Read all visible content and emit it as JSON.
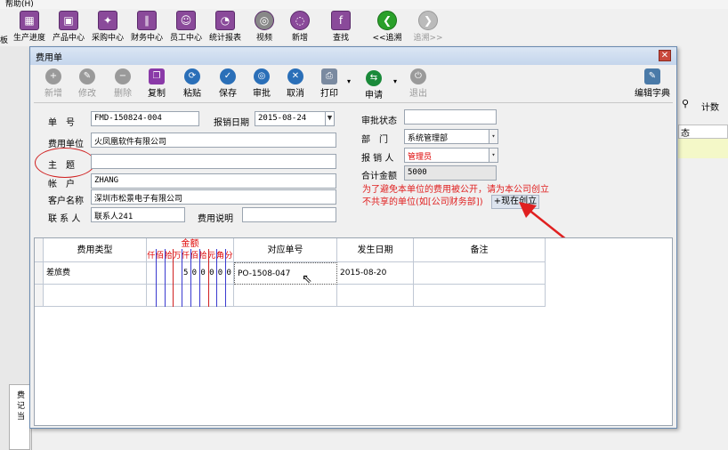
{
  "app": {
    "menu": "帮助(H)"
  },
  "main_toolbar": [
    {
      "label": "生产进度",
      "icon": "production-icon"
    },
    {
      "label": "产品中心",
      "icon": "product-icon"
    },
    {
      "label": "采购中心",
      "icon": "purchase-icon"
    },
    {
      "label": "财务中心",
      "icon": "finance-icon"
    },
    {
      "label": "员工中心",
      "icon": "staff-icon"
    },
    {
      "label": "统计报表",
      "icon": "report-icon"
    },
    {
      "label": "视频",
      "icon": "video-icon"
    },
    {
      "label": "新增",
      "icon": "new-icon"
    },
    {
      "label": "查找",
      "icon": "find-icon"
    },
    {
      "label": "<<追溯",
      "icon": "back-icon"
    },
    {
      "label": "追溯>>",
      "icon": "forward-icon"
    }
  ],
  "left": {
    "prefix": "板",
    "labels": [
      "费",
      "记",
      "当"
    ]
  },
  "right": {
    "count_label": "计数",
    "status_col": "态"
  },
  "dialog": {
    "title": "费用单",
    "toolbar": [
      {
        "label": "新增",
        "icon": "plus-icon",
        "enabled": false
      },
      {
        "label": "修改",
        "icon": "edit-icon",
        "enabled": false
      },
      {
        "label": "删除",
        "icon": "minus-icon",
        "enabled": false
      },
      {
        "label": "复制",
        "icon": "copy-icon",
        "enabled": true
      },
      {
        "label": "粘贴",
        "icon": "paste-icon",
        "enabled": true
      },
      {
        "label": "保存",
        "icon": "save-icon",
        "enabled": true
      },
      {
        "label": "审批",
        "icon": "approve-icon",
        "enabled": true
      },
      {
        "label": "取消",
        "icon": "cancel-icon",
        "enabled": true
      },
      {
        "label": "打印",
        "icon": "print-icon",
        "enabled": true
      },
      {
        "label": "申请",
        "icon": "apply-icon",
        "enabled": true
      },
      {
        "label": "退出",
        "icon": "exit-icon",
        "enabled": false
      },
      {
        "label": "编辑字典",
        "icon": "dictionary-icon",
        "enabled": true
      }
    ],
    "form": {
      "order_no_label": "单　号",
      "order_no": "FMD-150824-004",
      "date_label": "报销日期",
      "date": "2015-08-24",
      "unit_label": "费用单位",
      "unit": "火凤凰软件有限公司",
      "subject_label": "主　题",
      "subject": "",
      "account_label": "帐　户",
      "account": "ZHANG",
      "customer_label": "客户名称",
      "customer": "深圳市松景电子有限公司",
      "contact_label": "联 系 人",
      "contact": "联系人241",
      "desc_label": "费用说明",
      "desc": "",
      "status_label": "审批状态",
      "status": "",
      "dept_label": "部　门",
      "dept": "系统管理部",
      "reporter_label": "报 销 人",
      "reporter": "管理员",
      "total_label": "合计金额",
      "total": "5000"
    },
    "note": {
      "line1": "为了避免本单位的费用被公开，请为本公司创立",
      "line2": "不共享的单位(如[公司财务部])",
      "button": "+现在创立"
    },
    "grid": {
      "headers": {
        "type": "费用类型",
        "amount": "金额",
        "amount_units": [
          "仟",
          "佰",
          "拾",
          "万",
          "仟",
          "佰",
          "拾",
          "元",
          "角",
          "分"
        ],
        "ref": "对应单号",
        "date": "发生日期",
        "remark": "备注"
      },
      "rows": [
        {
          "type": "差旅费",
          "digits": [
            "",
            "",
            "",
            "",
            "5",
            "0",
            "0",
            "0",
            "0",
            "0"
          ],
          "ref": "PO-1508-047",
          "date": "2015-08-20",
          "remark": ""
        }
      ]
    }
  },
  "colors": {
    "accent": "#2a6fb8",
    "annotation": "#e02020"
  }
}
